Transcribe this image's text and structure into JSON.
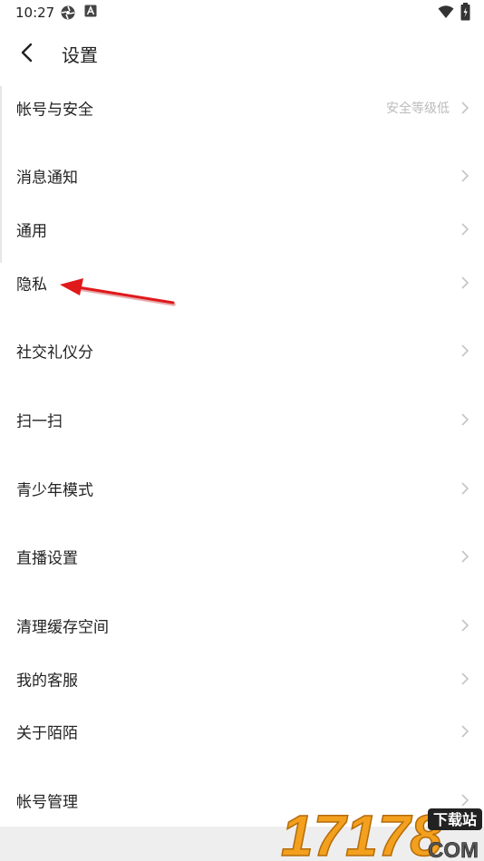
{
  "status": {
    "time": "10:27"
  },
  "header": {
    "title": "设置"
  },
  "rows": [
    {
      "label": "帐号与安全",
      "sub": "安全等级低"
    },
    {
      "label": "消息通知"
    },
    {
      "label": "通用"
    },
    {
      "label": "隐私"
    },
    {
      "label": "社交礼仪分"
    },
    {
      "label": "扫一扫"
    },
    {
      "label": "青少年模式"
    },
    {
      "label": "直播设置"
    },
    {
      "label": "清理缓存空间"
    },
    {
      "label": "我的客服"
    },
    {
      "label": "关于陌陌"
    },
    {
      "label": "帐号管理"
    }
  ],
  "watermark": {
    "number": "17178",
    "text": "下载站",
    "domain": "COM"
  },
  "colors": {
    "annotation_arrow": "#e0191b",
    "watermark_orange": "#f2a01e"
  }
}
